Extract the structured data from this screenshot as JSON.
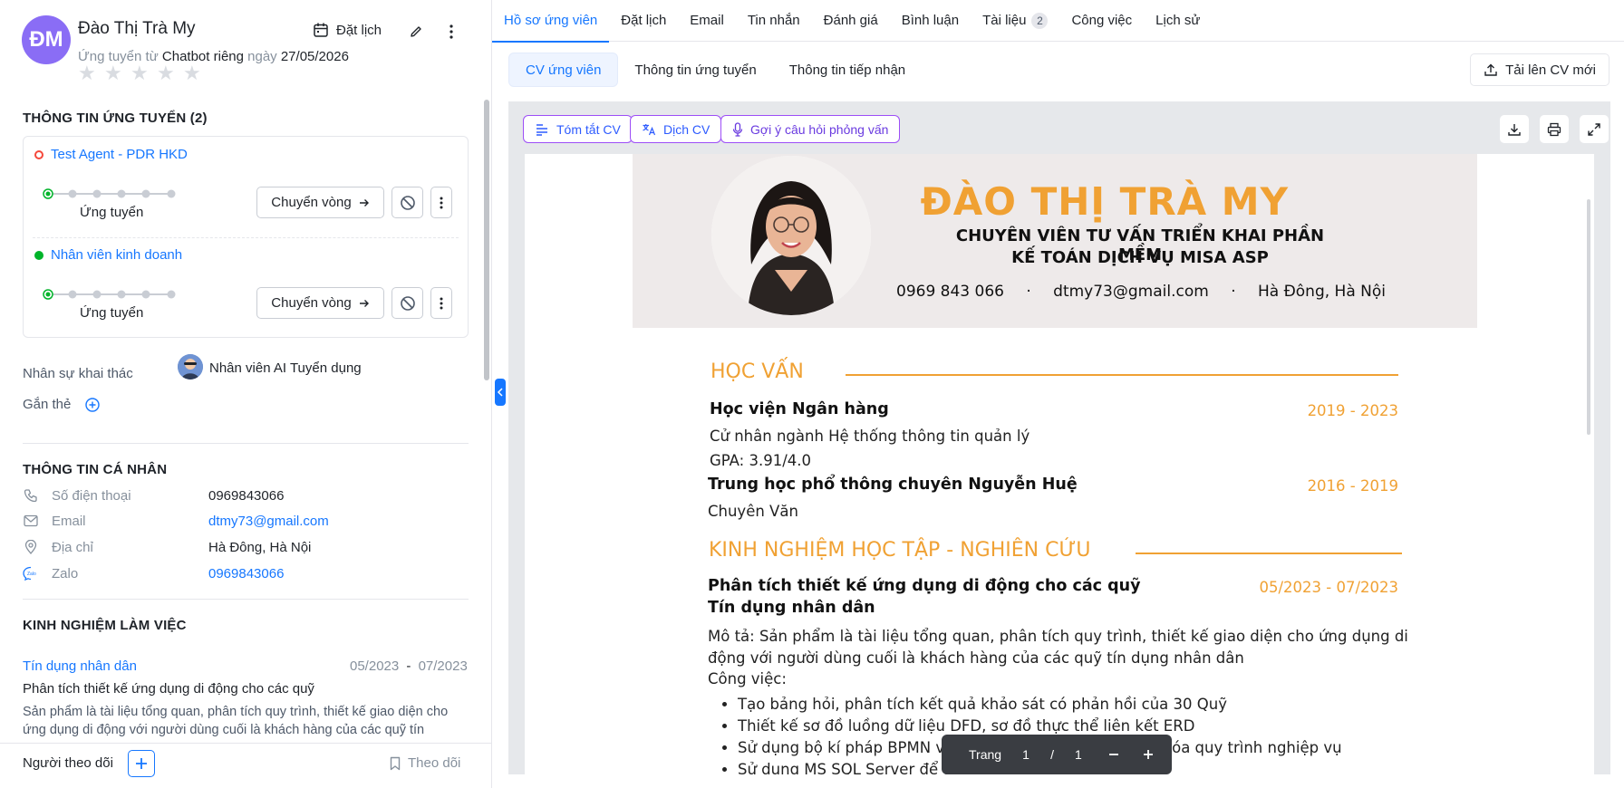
{
  "candidate": {
    "initials": "ĐM",
    "name": "Đào Thị Trà My",
    "applied_prefix": "Ứng tuyển từ",
    "applied_source": "Chatbot riêng",
    "applied_mid": "ngày",
    "applied_date": "27/05/2026",
    "rating": 0,
    "rating_max": 5
  },
  "header_actions": {
    "schedule_label": "Đặt lịch"
  },
  "applications": {
    "title": "THÔNG TIN ỨNG TUYỂN (2)",
    "items": [
      {
        "job": "Test Agent - PDR HKD",
        "status_color": "#f5483b",
        "stage": "Ứng tuyển",
        "move_label": "Chuyển vòng"
      },
      {
        "job": "Nhân viên kinh doanh",
        "status_color": "#00b42a",
        "stage": "Ứng tuyển",
        "move_label": "Chuyển vòng"
      }
    ]
  },
  "owner": {
    "label": "Nhân sự khai thác",
    "value": "Nhân viên AI Tuyển dụng"
  },
  "tags": {
    "label": "Gắn thẻ"
  },
  "personal": {
    "title": "THÔNG TIN CÁ NHÂN",
    "phone_label": "Số điện thoại",
    "phone": "0969843066",
    "email_label": "Email",
    "email": "dtmy73@gmail.com",
    "address_label": "Địa chỉ",
    "address": "Hà Đông, Hà Nội",
    "zalo_label": "Zalo",
    "zalo": "0969843066"
  },
  "work": {
    "title": "KINH NGHIỆM LÀM VIỆC",
    "company": "Tín dụng nhân dân",
    "period_start": "05/2023",
    "period_sep": "-",
    "period_end": "07/2023",
    "role": "Phân tích thiết kế ứng dụng di động cho các quỹ",
    "desc": "Sản phẩm là tài liệu tổng quan, phân tích quy trình, thiết kế giao diện cho ứng dụng di động với người dùng cuối là khách hàng của các quỹ tín"
  },
  "footer": {
    "followers_label": "Người theo dõi",
    "follow_label": "Theo dõi"
  },
  "tabs": [
    {
      "label": "Hồ sơ ứng viên",
      "active": true
    },
    {
      "label": "Đặt lịch"
    },
    {
      "label": "Email"
    },
    {
      "label": "Tin nhắn"
    },
    {
      "label": "Đánh giá"
    },
    {
      "label": "Bình luận"
    },
    {
      "label": "Tài liệu",
      "badge": "2"
    },
    {
      "label": "Công việc"
    },
    {
      "label": "Lịch sử"
    }
  ],
  "subtabs": [
    "CV ứng viên",
    "Thông tin ứng tuyển",
    "Thông tin tiếp nhận"
  ],
  "upload_label": "Tải lên CV mới",
  "cv_tools": [
    "Tóm tắt CV",
    "Dịch CV",
    "Gợi ý câu hỏi phỏng vấn"
  ],
  "cv": {
    "name": "ĐÀO THỊ TRÀ MY",
    "role_line1": "CHUYÊN VIÊN TƯ VẤN TRIỂN KHAI PHẦN MỀM",
    "role_line2": "KẾ TOÁN DỊCH VỤ MISA ASP",
    "phone": "0969 843 066",
    "email": "dtmy73@gmail.com",
    "location": "Hà Đông, Hà Nội",
    "contact_sep": "·",
    "education_title": "HỌC VẤN",
    "edu1_school": "Học viện Ngân hàng",
    "edu1_years": "2019 - 2023",
    "edu1_major": "Cử nhân ngành Hệ thống thông tin quản lý",
    "edu1_gpa": "GPA: 3.91/4.0",
    "edu2_school": "Trung học phổ thông chuyên Nguyễn Huệ",
    "edu2_years": "2016 - 2019",
    "edu2_major": "Chuyên Văn",
    "research_title": "KINH NGHIỆM HỌC TẬP - NGHIÊN CỨU",
    "proj_title_1": "Phân tích thiết kế ứng dụng di động cho các quỹ",
    "proj_title_2": "Tín dụng nhân dân",
    "proj_years": "05/2023 - 07/2023",
    "proj_desc": "Mô tả: Sản phẩm là tài liệu tổng quan, phân tích quy trình, thiết kế giao diện cho ứng dụng di động với người dùng cuối là khách hàng của các quỹ tín dụng nhân dân",
    "proj_tasks_label": "Công việc:",
    "proj_tasks": [
      "Tạo bảng hỏi, phân tích kết quả khảo sát có phản hồi của 30 Quỹ",
      "Thiết kế sơ đồ luồng dữ liệu DFD, sơ đồ thực thể liên kết ERD",
      "Sử dụng bộ kí pháp BPMN và Bizagi Modeler để mô hình hóa quy trình nghiệp vụ",
      "Sử dụng MS SQL Server để thiết kế cơ sở dữ liệu"
    ]
  },
  "pager": {
    "label": "Trang",
    "current": "1",
    "sep": "/",
    "total": "1"
  }
}
